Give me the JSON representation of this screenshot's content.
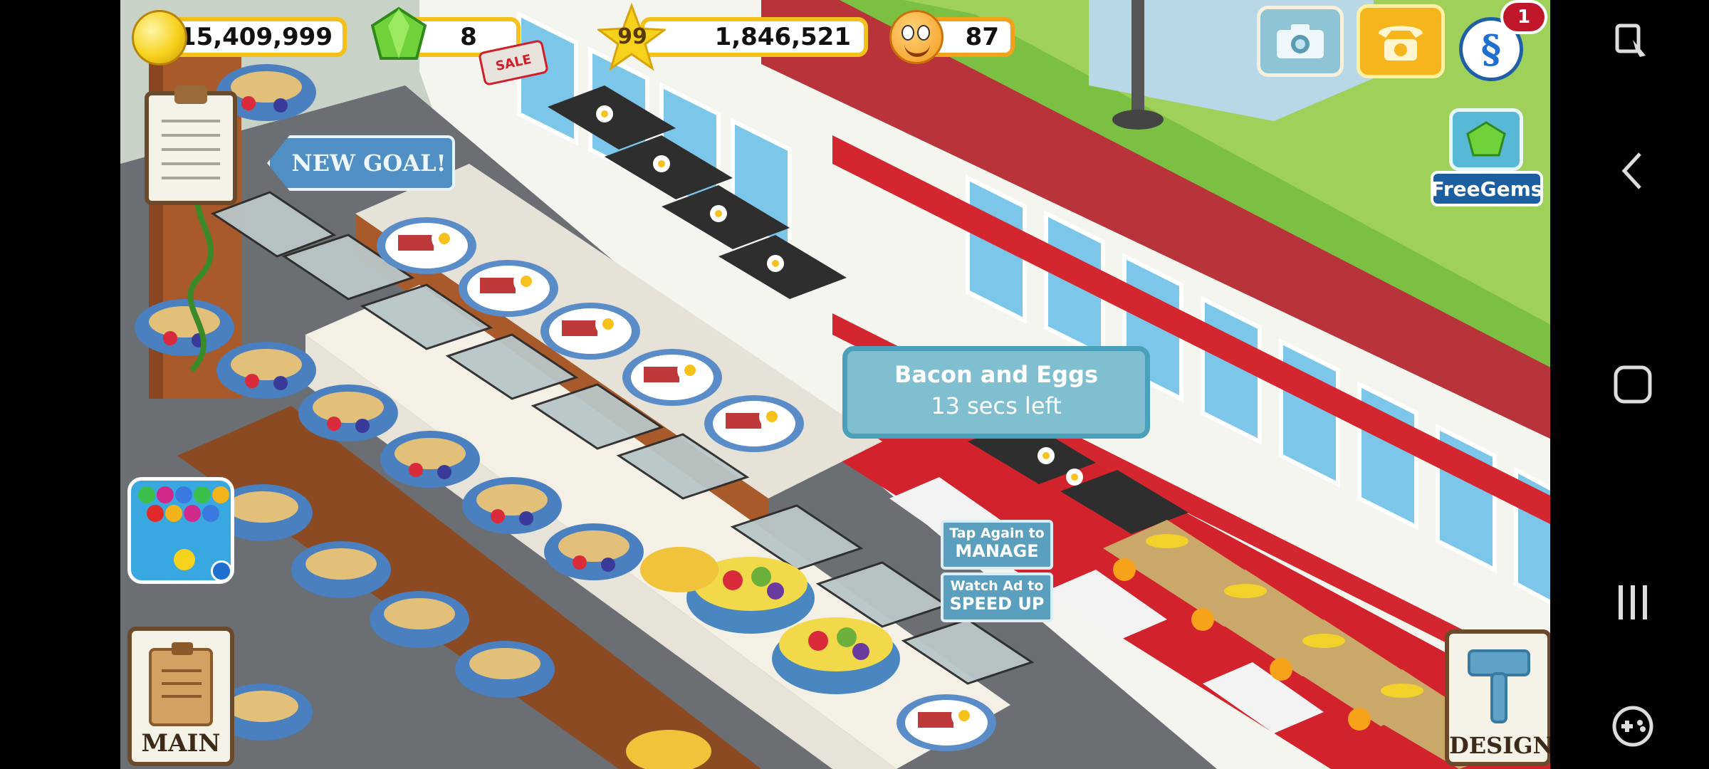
{
  "hud": {
    "coins": "15,409,999",
    "gems": "8",
    "sale_badge": "SALE",
    "level": "99",
    "xp": "1,846,521",
    "happiness": "87",
    "notification_count": "1",
    "free_gems_label": "FreeGems"
  },
  "goal_banner": "NEW GOAL!",
  "tooltip": {
    "title": "Bacon and Eggs",
    "subtitle": "13 secs left"
  },
  "actions": {
    "manage_line1": "Tap Again to",
    "manage_line2": "MANAGE",
    "speedup_line1": "Watch Ad to",
    "speedup_line2": "SPEED UP"
  },
  "buttons": {
    "main": "MAIN",
    "design": "DESIGN"
  },
  "colors": {
    "counter_red": "#c8202a",
    "wall_brick": "#b8333a",
    "hud_gold": "#f2c21a",
    "tooltip_blue": "#7fbed0"
  }
}
